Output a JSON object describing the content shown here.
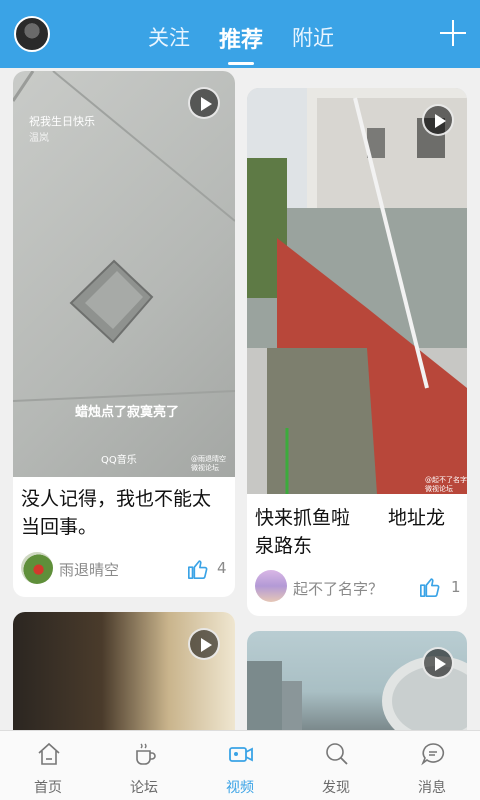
{
  "header": {
    "tabs": [
      {
        "label": "关注"
      },
      {
        "label": "推荐"
      },
      {
        "label": "附近"
      }
    ],
    "active_tab": "推荐",
    "accent_color": "#3aa3e6",
    "add_icon": "plus-icon"
  },
  "feed": {
    "cards": [
      {
        "overlay_top": "祝我生日快乐",
        "overlay_top_sub": "温岚",
        "overlay_caption": "蜡烛点了寂寞亮了",
        "overlay_brand": "QQ音乐",
        "overlay_watermark": "@雨退晴空\n微视论坛",
        "title": "没人记得，我也不能太当回事。",
        "author": "雨退晴空",
        "likes": "4"
      },
      {
        "overlay_watermark": "@起不了名字?\n微视论坛",
        "title": "快来抓鱼啦　　地址龙泉路东",
        "author": "起不了名字？",
        "likes": "1"
      },
      {
        "title": ""
      },
      {
        "title": ""
      }
    ]
  },
  "bottom_nav": {
    "items": [
      {
        "label": "首页",
        "icon": "home-icon"
      },
      {
        "label": "论坛",
        "icon": "cup-icon"
      },
      {
        "label": "视频",
        "icon": "video-icon"
      },
      {
        "label": "发现",
        "icon": "search-icon"
      },
      {
        "label": "消息",
        "icon": "message-icon"
      }
    ],
    "active": "视频"
  }
}
